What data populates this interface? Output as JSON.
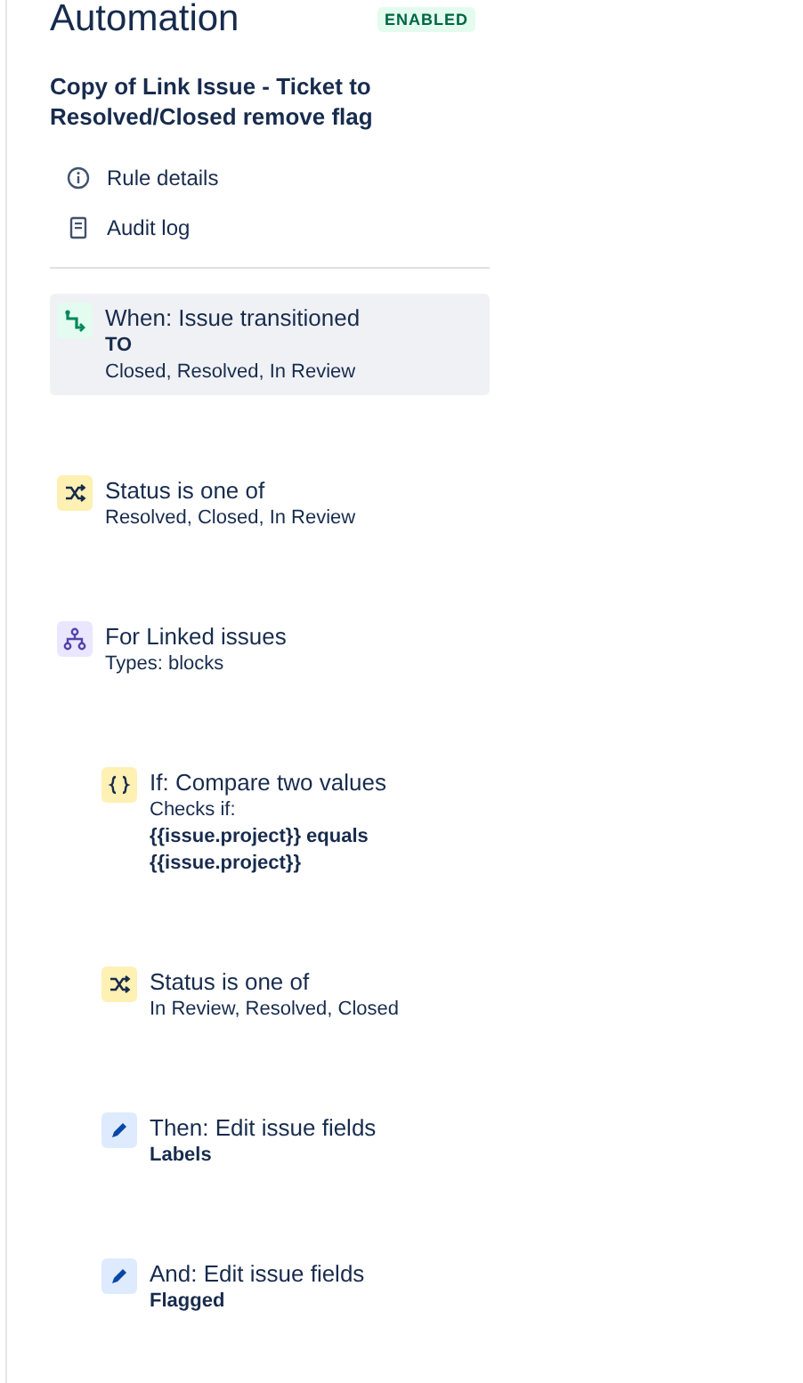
{
  "header": {
    "title": "Automation",
    "status": "ENABLED",
    "enabled": true
  },
  "rule_name": "Copy of Link Issue - Ticket to Resolved/Closed remove flag",
  "menu": [
    {
      "label": "Rule details",
      "kind": "info"
    },
    {
      "label": "Audit log",
      "kind": "log"
    }
  ],
  "steps": [
    {
      "kind": "trigger",
      "selected": true,
      "title": "When: Issue transitioned",
      "details": [
        {
          "text": "TO",
          "strong": true
        },
        {
          "text": "Closed, Resolved, In Review",
          "strong": false
        }
      ]
    },
    {
      "kind": "condition",
      "selected": false,
      "title": "Status is one of",
      "details": [
        {
          "text": "Resolved, Closed, In Review",
          "strong": false
        }
      ]
    },
    {
      "kind": "branch",
      "selected": false,
      "title": "For Linked issues",
      "details": [
        {
          "text": "Types: blocks",
          "strong": false
        }
      ],
      "children": [
        {
          "kind": "compare",
          "selected": false,
          "title": "If: Compare two values",
          "details": [
            {
              "text": "Checks if:",
              "strong": false
            },
            {
              "text": "{{issue.project}} equals {{issue.project}}",
              "strong": true
            }
          ]
        },
        {
          "kind": "condition",
          "selected": false,
          "title": "Status is one of",
          "details": [
            {
              "text": "In Review, Resolved, Closed",
              "strong": false
            }
          ]
        },
        {
          "kind": "action",
          "selected": false,
          "title": "Then: Edit issue fields",
          "details": [
            {
              "text": "Labels",
              "strong": true
            }
          ]
        },
        {
          "kind": "action",
          "selected": false,
          "title": "And: Edit issue fields",
          "details": [
            {
              "text": "Flagged",
              "strong": true
            }
          ]
        }
      ]
    }
  ]
}
